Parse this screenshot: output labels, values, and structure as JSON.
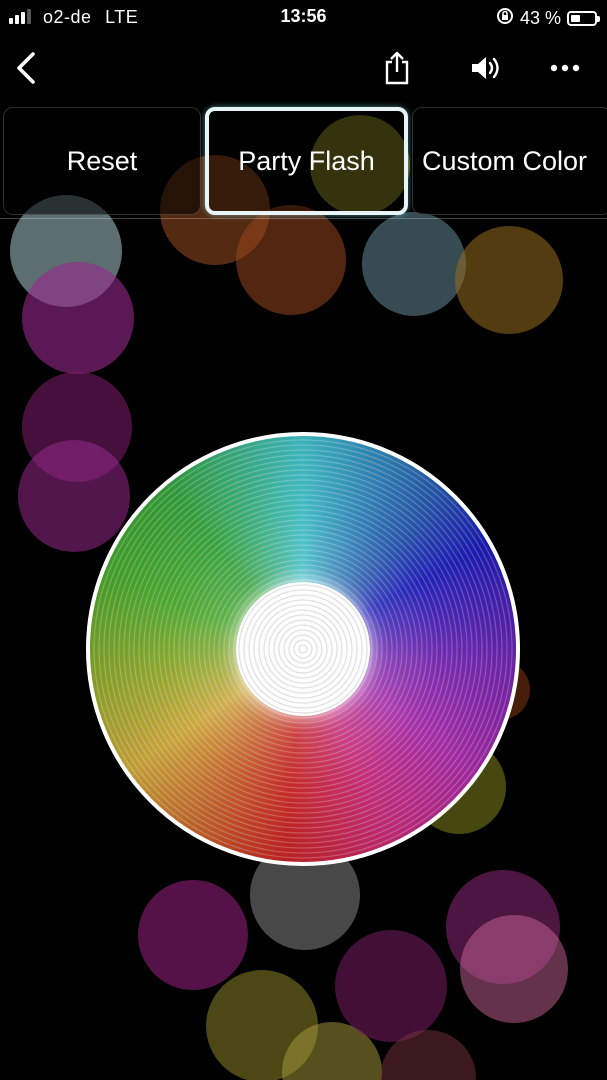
{
  "status_bar": {
    "carrier": "o2-de",
    "network": "LTE",
    "time": "13:56",
    "battery_percent": "43 %",
    "battery_level": 0.43,
    "icons": [
      "signal-icon",
      "rotation-lock-icon",
      "battery-icon"
    ]
  },
  "nav": {
    "icons": [
      "back-chevron-icon",
      "share-icon",
      "speaker-icon",
      "more-icon"
    ]
  },
  "tabs": [
    {
      "label": "Reset",
      "selected": false
    },
    {
      "label": "Party Flash",
      "selected": true
    },
    {
      "label": "Custom Color",
      "selected": false
    }
  ],
  "colors": {
    "background": "#000000",
    "selected_border": "#e8f4f6",
    "wheel_ring": "#ffffff"
  },
  "color_wheel": {
    "icon": "color-wheel"
  }
}
